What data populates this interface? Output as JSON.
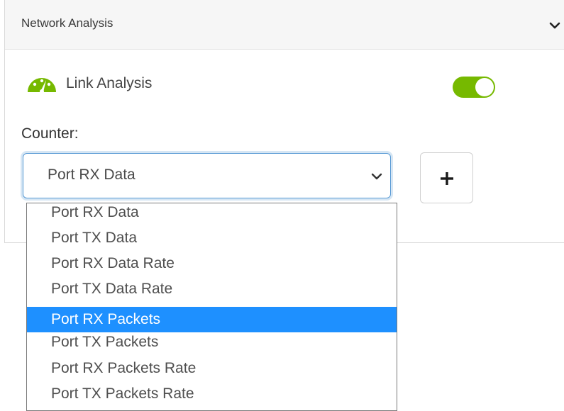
{
  "panel": {
    "title": "Network Analysis",
    "collapse_icon": "chevron-down-icon"
  },
  "link_analysis": {
    "icon": "speedometer-icon",
    "label": "Link Analysis",
    "toggle_on": true,
    "toggle_color": "#76b900"
  },
  "counter": {
    "label": "Counter:",
    "selected_value": "Port RX Data",
    "add_icon": "plus-icon",
    "options": [
      "Port RX Data",
      "Port TX Data",
      "Port RX Data Rate",
      "Port TX Data Rate",
      "Port RX Packets",
      "Port TX Packets",
      "Port RX Packets Rate",
      "Port TX Packets Rate"
    ],
    "highlighted_option": "Port RX Packets",
    "highlight_color": "#1e90ff"
  }
}
